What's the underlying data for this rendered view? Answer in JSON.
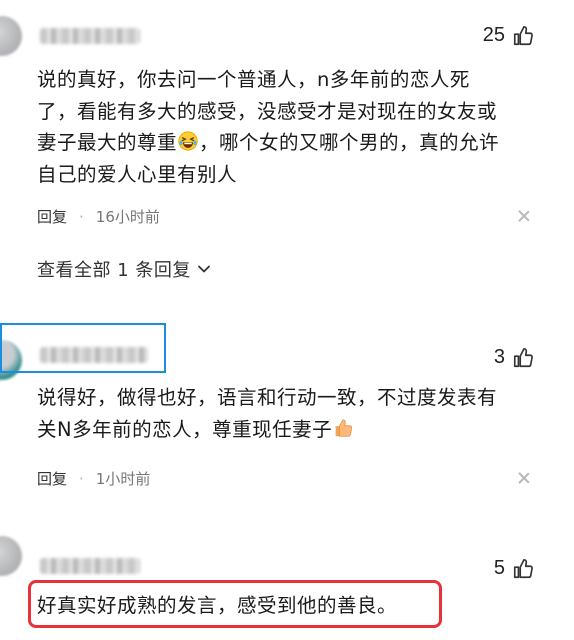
{
  "comments": [
    {
      "likes": "25",
      "text_lines": [
        "说的真好，你去问一个普通人，n多年前的恋人死",
        "了，看能有多大的感受，没感受才是对现在的女友或",
        "妻子最大的尊重",
        "，哪个女的又哪个男的，真的允许",
        "自己的爱人心里有别人"
      ],
      "emoji_name": "laughing-crying-emoji",
      "reply_label": "回复",
      "time": "16小时前",
      "view_replies": "查看全部 1 条回复"
    },
    {
      "likes": "3",
      "text_lines": [
        "说得好，做得也好，语言和行动一致，不过度发表有",
        "关N多年前的恋人，尊重现任妻子"
      ],
      "emoji_name": "thumbs-up-emoji",
      "reply_label": "回复",
      "time": "1小时前"
    },
    {
      "likes": "5",
      "text": "好真实好成熟的发言，感受到他的善良。"
    }
  ],
  "colors": {
    "highlight_blue": "#1a8fe0",
    "highlight_red": "#e8323a"
  }
}
